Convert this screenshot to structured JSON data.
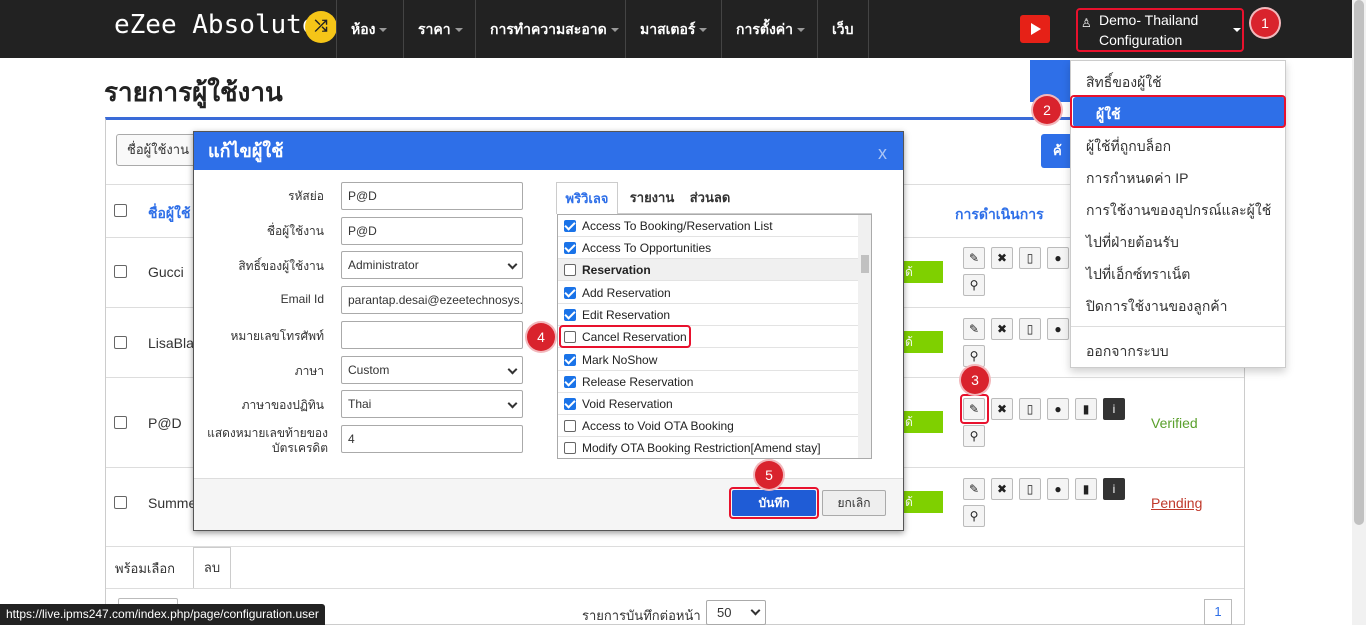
{
  "navbar": {
    "brand": "eZee Absolute",
    "menu": [
      "ห้อง",
      "ราคา",
      "การทำความสะอาด",
      "มาสเตอร์",
      "การตั้งค่า",
      "เว็บ"
    ],
    "user_line1": "Demo- Thailand",
    "user_line2": "Configuration"
  },
  "markers": [
    "1",
    "2",
    "3",
    "4",
    "5"
  ],
  "page": {
    "title": "รายการผู้ใช้งาน",
    "search_label": "ชื่อผู้ใช้งาน",
    "search_button_partial": "ค้",
    "header_username": "ชื่อผู้ใช้",
    "header_actions": "การดำเนินการ",
    "rows": [
      {
        "name": "Gucci",
        "status_text": "ด้"
      },
      {
        "name": "LisaBla",
        "status_text": "ด้"
      },
      {
        "name": "P@D",
        "status_text": "ด้",
        "verify": "Verified"
      },
      {
        "name": "Summe",
        "status_text": "ด้",
        "verify": "Pending"
      }
    ],
    "footer_tab_select": "พร้อมเลือก",
    "footer_tab_delete": "ลบ",
    "records_label": "รายการบันทึกต่อหน้า",
    "records_value": "50",
    "page_number": "1"
  },
  "dialog": {
    "title": "แก้ไขผู้ใช้",
    "close": "x",
    "fields": [
      {
        "label": "รหัสย่อ",
        "value": "P@D"
      },
      {
        "label": "ชื่อผู้ใช้งาน",
        "value": "P@D"
      },
      {
        "label": "สิทธิ์ของผู้ใช้งาน",
        "value": "Administrator"
      },
      {
        "label": "Email Id",
        "value": "parantap.desai@ezeetechnosys.c"
      },
      {
        "label": "หมายเลขโทรศัพท์",
        "value": ""
      },
      {
        "label": "ภาษา",
        "value": "Custom"
      },
      {
        "label": "ภาษาของปฏิทิน",
        "value": "Thai"
      },
      {
        "label": "แสดงหมายเลขท้ายของบัตรเครดิต",
        "value": "4"
      }
    ],
    "tabs": [
      "พริวิเลจ",
      "รายงาน",
      "ส่วนลด"
    ],
    "privileges": [
      {
        "label": "Access To Booking/Reservation List",
        "checked": true
      },
      {
        "label": "Access To Opportunities",
        "checked": true
      },
      {
        "label": "Reservation",
        "checked": false,
        "header": true
      },
      {
        "label": "Add Reservation",
        "checked": true
      },
      {
        "label": "Edit Reservation",
        "checked": true
      },
      {
        "label": "Cancel Reservation",
        "checked": false
      },
      {
        "label": "Mark NoShow",
        "checked": true
      },
      {
        "label": "Release Reservation",
        "checked": true
      },
      {
        "label": "Void Reservation",
        "checked": true
      },
      {
        "label": "Access to Void OTA Booking",
        "checked": false
      },
      {
        "label": "Modify OTA Booking Restriction[Amend stay]",
        "checked": false
      }
    ],
    "save": "บันทึก",
    "cancel": "ยกเลิก"
  },
  "dropdown": {
    "items": [
      "สิทธิ์ของผู้ใช้",
      "ผู้ใช้",
      "ผู้ใช้ที่ถูกบล็อก",
      "การกำหนดค่า IP",
      "การใช้งานของอุปกรณ์และผู้ใช้",
      "ไปที่ฝ่ายต้อนรับ",
      "ไปที่เอ็กซ์ทราเน็ต",
      "ปิดการใช้งานของลูกค้า",
      "ออกจากระบบ"
    ]
  },
  "status_url": "https://live.ipms247.com/index.php/page/configuration.user"
}
